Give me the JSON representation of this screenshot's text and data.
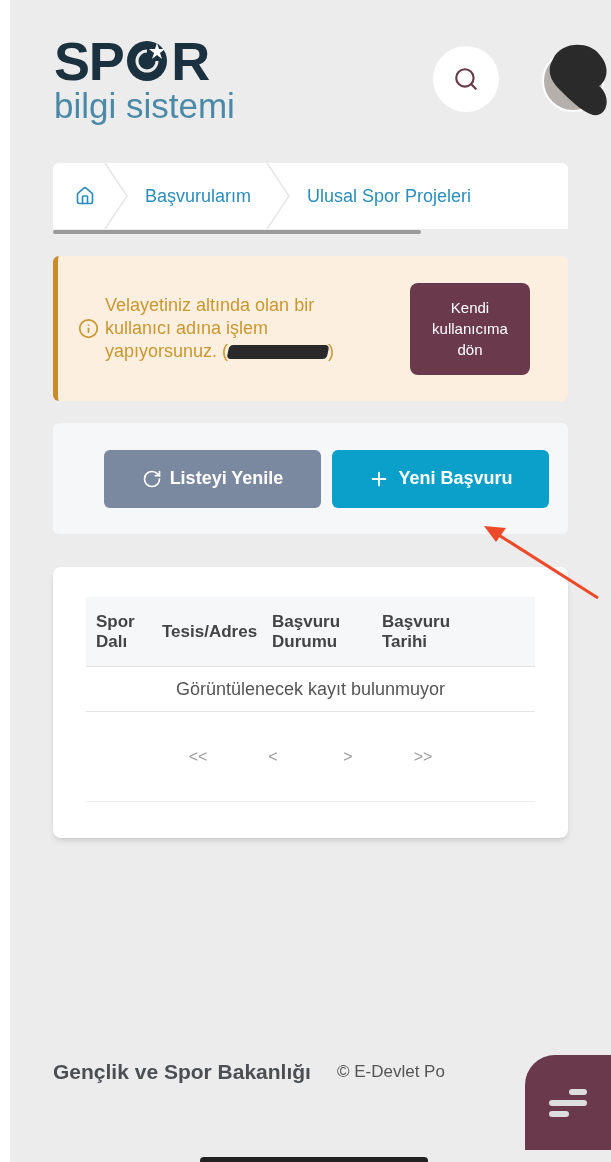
{
  "logo": {
    "left": "SP",
    "right": "R",
    "subtitle": "bilgi sistemi"
  },
  "breadcrumb": [
    {
      "label": "Başvurularım"
    },
    {
      "label": "Ulusal Spor Projeleri"
    }
  ],
  "alert": {
    "message": "Velayetiniz altında olan bir kullanıcı adına işlem yapıyorsunuz. (",
    "message_end": ")",
    "button": "Kendi kullanıcıma dön"
  },
  "actions": [
    {
      "kind": "refresh",
      "label": "Listeyi Yenile"
    },
    {
      "kind": "add",
      "label": "Yeni Başvuru"
    }
  ],
  "table": {
    "columns": [
      "Spor Dalı",
      "Tesis/Adres",
      "Başvuru Durumu",
      "Başvuru Tarihi"
    ],
    "empty": "Görüntülenecek kayıt bulunmuyor"
  },
  "pagination": [
    "<<",
    "<",
    ">",
    ">>"
  ],
  "footer": {
    "ministry": "Gençlik ve Spor Bakanlığı",
    "copyright": "© E-Devlet Po"
  }
}
